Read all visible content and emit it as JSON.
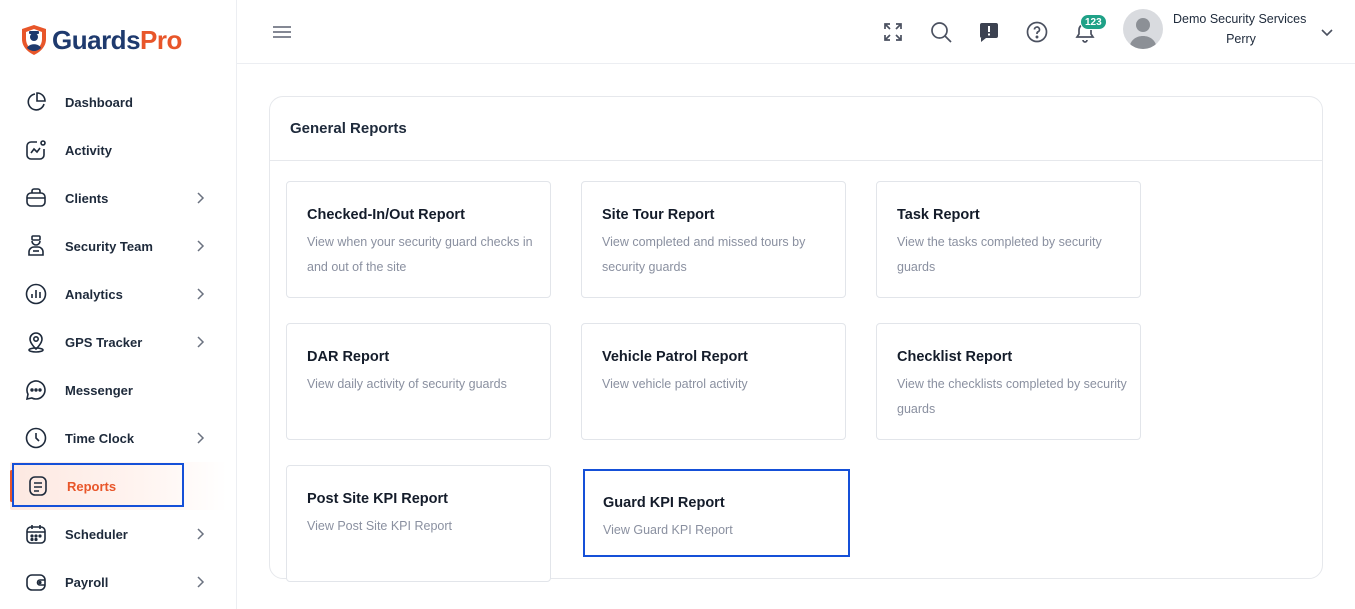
{
  "brand": {
    "name_part1": "Guards",
    "name_part2": "Pro",
    "accent": "#e8562a",
    "navy": "#1e3a6e"
  },
  "sidebar": {
    "items": [
      {
        "label": "Dashboard",
        "icon": "pie-chart-icon",
        "has_submenu": false
      },
      {
        "label": "Activity",
        "icon": "activity-icon",
        "has_submenu": false
      },
      {
        "label": "Clients",
        "icon": "briefcase-icon",
        "has_submenu": true
      },
      {
        "label": "Security Team",
        "icon": "guard-icon",
        "has_submenu": true
      },
      {
        "label": "Analytics",
        "icon": "analytics-icon",
        "has_submenu": true
      },
      {
        "label": "GPS Tracker",
        "icon": "location-pin-icon",
        "has_submenu": true
      },
      {
        "label": "Messenger",
        "icon": "chat-icon",
        "has_submenu": false
      },
      {
        "label": "Time Clock",
        "icon": "clock-icon",
        "has_submenu": true
      },
      {
        "label": "Reports",
        "icon": "document-icon",
        "has_submenu": false,
        "active": true
      },
      {
        "label": "Scheduler",
        "icon": "calendar-icon",
        "has_submenu": true
      },
      {
        "label": "Payroll",
        "icon": "wallet-icon",
        "has_submenu": true
      }
    ]
  },
  "header": {
    "icons": [
      "menu-icon",
      "fullscreen-icon",
      "search-icon",
      "feedback-icon",
      "help-icon",
      "bell-icon"
    ],
    "notification_count": "123",
    "user": {
      "company": "Demo Security Services",
      "name": "Perry"
    }
  },
  "main": {
    "section_title": "General Reports",
    "cards": [
      {
        "title": "Checked-In/Out Report",
        "description": "View when your security guard checks in and out of the site"
      },
      {
        "title": "Site Tour Report",
        "description": "View completed and missed tours by security guards"
      },
      {
        "title": "Task Report",
        "description": "View the tasks completed by security guards"
      },
      {
        "title": "DAR Report",
        "description": "View daily activity of security guards"
      },
      {
        "title": "Vehicle Patrol Report",
        "description": "View vehicle patrol activity"
      },
      {
        "title": "Checklist Report",
        "description": "View the checklists completed by security guards"
      },
      {
        "title": "Post Site KPI Report",
        "description": "View Post Site KPI Report"
      },
      {
        "title": "Guard KPI Report",
        "description": "View Guard KPI Report"
      }
    ]
  }
}
